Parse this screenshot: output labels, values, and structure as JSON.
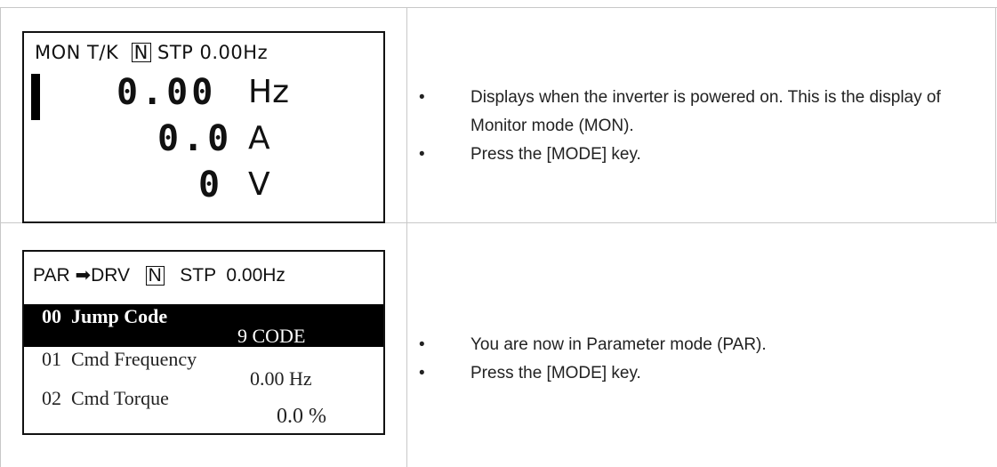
{
  "row1": {
    "lcd": {
      "status_mode": "MON",
      "status_tk": "T/K",
      "status_n": "N",
      "status_stp": "STP",
      "status_freq": "0.00Hz",
      "line1_value": "0.00",
      "line1_unit": "Hz",
      "line2_value": "0.0",
      "line2_unit": "A",
      "line3_value": "0",
      "line3_unit": "V"
    },
    "bullets": [
      "Displays when the inverter is powered on. This is the display of Monitor mode (MON).",
      "Press the [MODE] key."
    ]
  },
  "row2": {
    "lcd": {
      "status_mode": "PAR",
      "status_arrow": "➡",
      "status_group": "DRV",
      "status_n": "N",
      "status_stp": "STP",
      "status_freq": "0.00Hz",
      "rows": [
        {
          "code": "00",
          "name": "Jump Code",
          "value": "9 CODE"
        },
        {
          "code": "01",
          "name": "Cmd Frequency",
          "value": "0.00 Hz"
        },
        {
          "code": "02",
          "name": "Cmd Torque",
          "value": "0.0 %"
        }
      ]
    },
    "bullets": [
      "You are now in Parameter mode (PAR).",
      "Press the [MODE] key."
    ]
  }
}
